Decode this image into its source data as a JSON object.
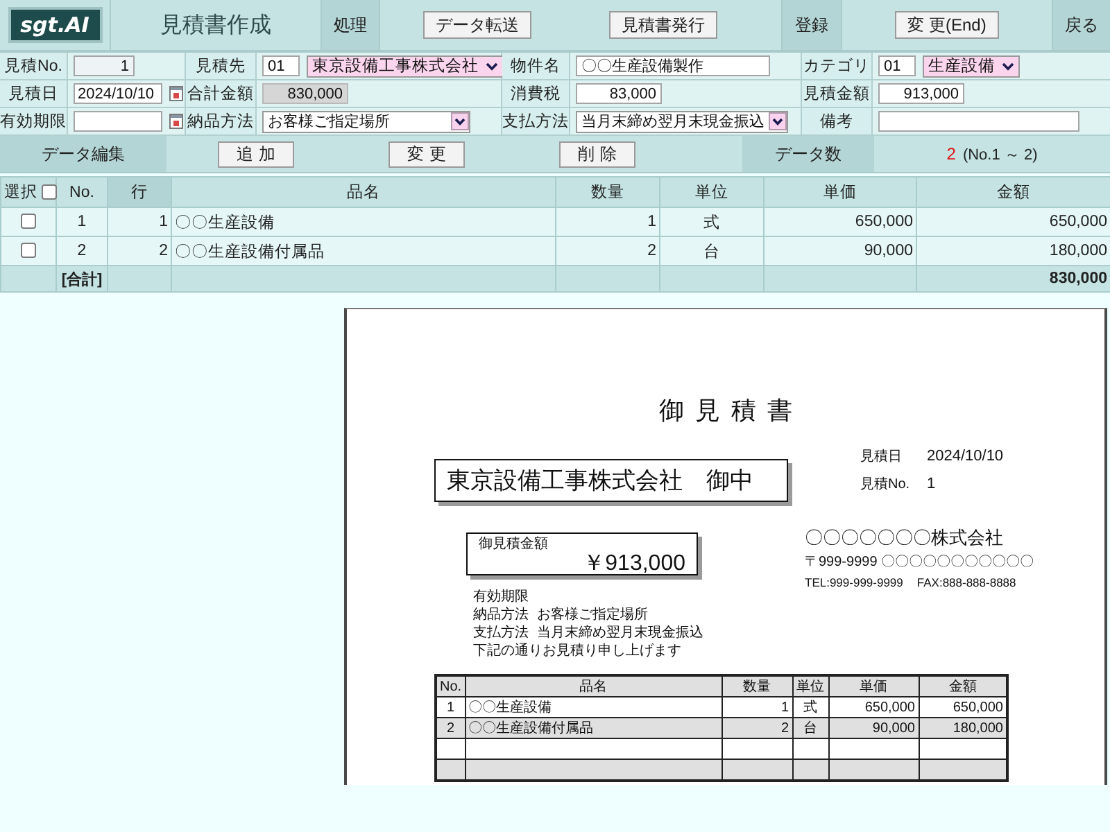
{
  "header": {
    "logo": "sgt.AI",
    "title": "見積書作成",
    "groups": [
      {
        "label": "処理",
        "buttons": [
          "データ転送",
          "見積書発行"
        ]
      },
      {
        "label": "登録",
        "buttons": [
          "変 更(End)"
        ]
      }
    ],
    "back": "戻る"
  },
  "form": {
    "rows": [
      [
        {
          "label": "見積No.",
          "kind": "id",
          "value": "1"
        },
        {
          "label": "見積先",
          "kind": "code_select",
          "code": "01",
          "value": "東京設備工事株式会社"
        },
        {
          "label": "物件名",
          "kind": "text",
          "value": "〇〇生産設備製作"
        },
        {
          "label": "カテゴリ",
          "kind": "code_select",
          "code": "01",
          "value": "生産設備"
        }
      ],
      [
        {
          "label": "見積日",
          "kind": "date",
          "value": "2024/10/10"
        },
        {
          "label": "合計金額",
          "kind": "total",
          "value": "830,000"
        },
        {
          "label": "消費税",
          "kind": "amount",
          "value": "83,000"
        },
        {
          "label": "見積金額",
          "kind": "amount",
          "value": "913,000"
        }
      ],
      [
        {
          "label": "有効期限",
          "kind": "date"
        },
        {
          "label": "納品方法",
          "kind": "select",
          "value": "お客様ご指定場所"
        },
        {
          "label": "支払方法",
          "kind": "select",
          "value": "当月末締め翌月末現金振込"
        },
        {
          "label": "備考",
          "kind": "text"
        }
      ]
    ]
  },
  "edit_bar": {
    "label": "データ編集",
    "buttons": [
      "追加",
      "変更",
      "削除"
    ],
    "count_label": "データ数",
    "count": "2",
    "range": "(No.1 ～ 2)"
  },
  "table": {
    "select_all": false,
    "columns": [
      {
        "label": "選択",
        "highlighted": false
      },
      {
        "label": "No.",
        "highlighted": false
      },
      {
        "label": "行",
        "highlighted": true
      },
      {
        "label": "品名",
        "highlighted": false
      },
      {
        "label": "数量",
        "highlighted": false
      },
      {
        "label": "単位",
        "highlighted": false
      },
      {
        "label": "単価",
        "highlighted": false
      },
      {
        "label": "金額",
        "highlighted": false
      }
    ],
    "rows": [
      {
        "checked": false,
        "cells": [
          "",
          "1",
          "1",
          "〇〇生産設備",
          "1",
          "式",
          "650,000",
          "650,000"
        ]
      },
      {
        "checked": false,
        "cells": [
          "",
          "2",
          "2",
          "〇〇生産設備付属品",
          "2",
          "台",
          "90,000",
          "180,000"
        ]
      }
    ],
    "total": {
      "cells": [
        "",
        "[合計]",
        "",
        "",
        "",
        "",
        "",
        "830,000"
      ]
    }
  },
  "document": {
    "title": "御見積書",
    "recipient": "東京設備工事株式会社　御中",
    "meta": [
      {
        "label": "見積日",
        "value": "2024/10/10"
      },
      {
        "label": "見積No.",
        "value": "1"
      }
    ],
    "amount": {
      "label": "御見積金額",
      "value": "￥913,000"
    },
    "issuer": {
      "name": "〇〇〇〇〇〇〇株式会社",
      "address": "〒999-9999 〇〇〇〇〇〇〇〇〇〇〇",
      "contact": [
        "TEL:999-999-9999",
        "FAX:888-888-8888"
      ]
    },
    "terms": [
      {
        "label": "有効期限"
      },
      {
        "label": "納品方法",
        "value": "お客様ご指定場所"
      },
      {
        "label": "支払方法",
        "value": "当月末締め翌月末現金振込"
      }
    ],
    "note": "下記の通りお見積り申し上げます",
    "table": {
      "columns": [
        "No.",
        "品名",
        "数量",
        "単位",
        "単価",
        "金額"
      ],
      "rows": [
        {
          "kind": "item",
          "cells": [
            "1",
            "〇〇生産設備",
            "1",
            "式",
            "650,000",
            "650,000"
          ]
        },
        {
          "kind": "item",
          "cells": [
            "2",
            "〇〇生産設備付属品",
            "2",
            "台",
            "90,000",
            "180,000"
          ]
        },
        {
          "kind": "blank"
        },
        {
          "kind": "blank"
        }
      ]
    }
  }
}
